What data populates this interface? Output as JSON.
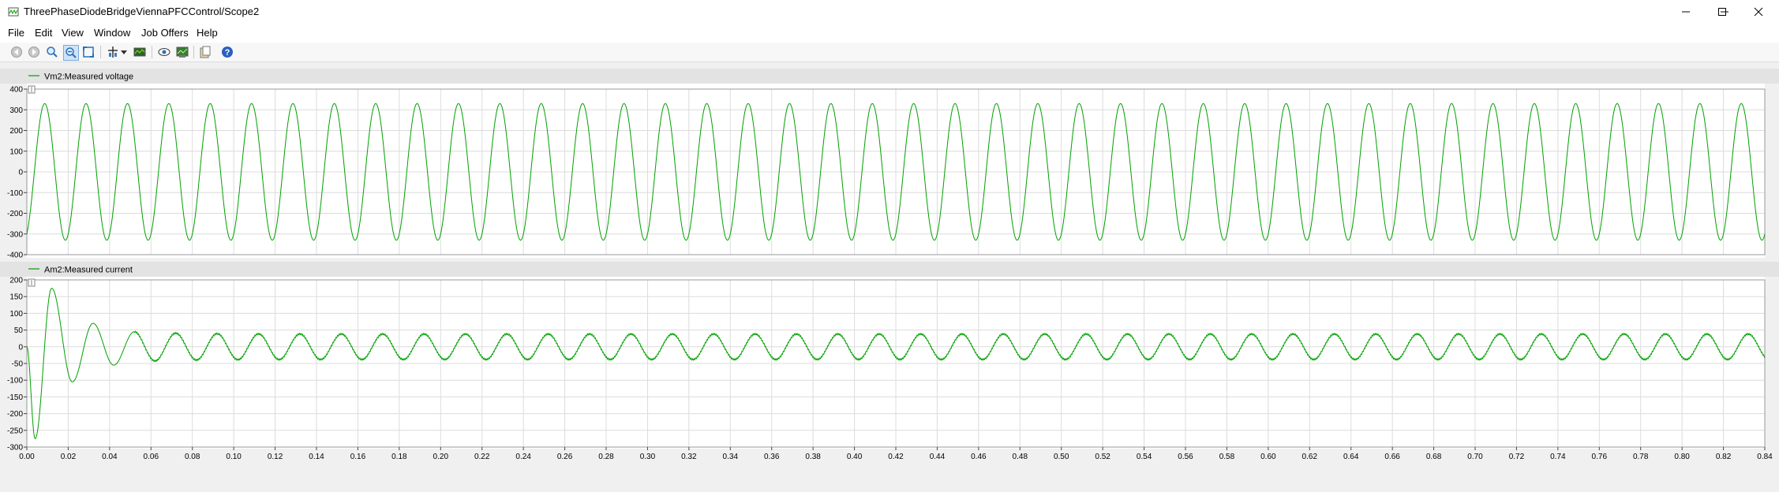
{
  "window": {
    "title": "ThreePhaseDiodeBridgeViennaPFCControl/Scope2"
  },
  "menu": {
    "items": [
      "File",
      "Edit",
      "View",
      "Window",
      "Job Offers",
      "Help"
    ]
  },
  "toolbar": {
    "icons": [
      "back-icon",
      "forward-icon",
      "zoom-in-icon",
      "zoom-out-icon",
      "fit-to-view-icon",
      "cursor-tool-icon",
      "dropdown-arrow-icon",
      "signal-view-icon",
      "eye-icon",
      "save-plot-icon",
      "copy-icon",
      "help-icon"
    ]
  },
  "colors": {
    "trace": "#00a000",
    "plot_bg": "#ffffff",
    "legend_bar": "#e3e3e3",
    "grid": "#dcdcdc"
  },
  "chart_data": [
    {
      "type": "line",
      "legend": "Vm2:Measured voltage",
      "x_range": [
        0.0,
        0.84
      ],
      "ylim": [
        -400,
        400
      ],
      "y_ticks": [
        "400",
        "300",
        "200",
        "100",
        "0",
        "-100",
        "-200",
        "-300",
        "-400"
      ],
      "grid": true,
      "series": [
        {
          "name": "Vm2:Measured voltage",
          "waveform": "sine",
          "amplitude": 330,
          "frequency_hz": 50,
          "phase_start_value": -300,
          "t_start": 0.0,
          "t_end": 0.84
        }
      ]
    },
    {
      "type": "line",
      "legend": "Am2:Measured current",
      "x_range": [
        0.0,
        0.84
      ],
      "ylim": [
        -300,
        200
      ],
      "y_ticks": [
        "200",
        "150",
        "100",
        "50",
        "0",
        "-50",
        "-100",
        "-150",
        "-200",
        "-250",
        "-300"
      ],
      "x_ticks": [
        "0.00",
        "0.02",
        "0.04",
        "0.06",
        "0.08",
        "0.10",
        "0.12",
        "0.14",
        "0.16",
        "0.18",
        "0.20",
        "0.22",
        "0.24",
        "0.26",
        "0.28",
        "0.30",
        "0.32",
        "0.34",
        "0.36",
        "0.38",
        "0.40",
        "0.42",
        "0.44",
        "0.46",
        "0.48",
        "0.50",
        "0.52",
        "0.54",
        "0.56",
        "0.58",
        "0.60",
        "0.62",
        "0.64",
        "0.66",
        "0.68",
        "0.70",
        "0.72",
        "0.74",
        "0.76",
        "0.78",
        "0.80",
        "0.82",
        "0.84"
      ],
      "grid": true,
      "series": [
        {
          "name": "Am2:Measured current",
          "waveform": "damped-sine-then-steady",
          "steady_amplitude": 38,
          "frequency_hz": 50,
          "transient_peaks": [
            {
              "t": 0.004,
              "v": -275
            },
            {
              "t": 0.012,
              "v": 175
            },
            {
              "t": 0.022,
              "v": -105
            },
            {
              "t": 0.032,
              "v": 70
            },
            {
              "t": 0.042,
              "v": -55
            },
            {
              "t": 0.052,
              "v": 45
            }
          ],
          "t_start": 0.0,
          "t_end": 0.84
        }
      ]
    }
  ]
}
